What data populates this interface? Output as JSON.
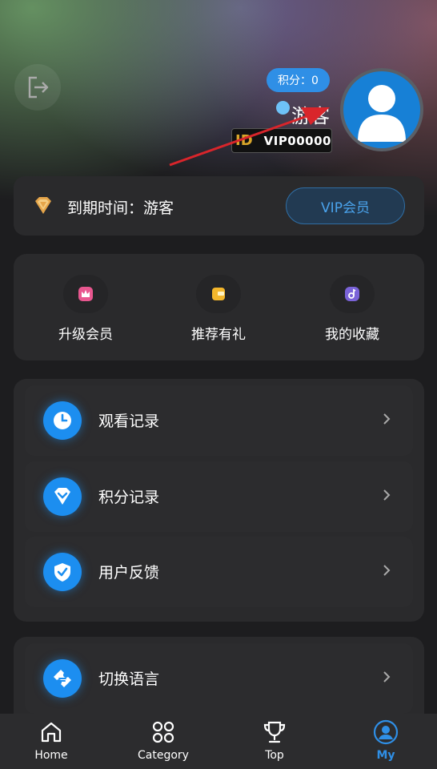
{
  "header": {
    "points_badge": "积分：0",
    "username": "游客",
    "id_tag": "ID",
    "id_value": "VIP00000"
  },
  "vip_bar": {
    "expiry_text": "到期时间：游客",
    "vip_button": "VIP会员"
  },
  "quick_actions": [
    {
      "label": "升级会员",
      "icon": "crown-icon"
    },
    {
      "label": "推荐有礼",
      "icon": "gift-card-icon"
    },
    {
      "label": "我的收藏",
      "icon": "music-note-icon"
    }
  ],
  "menu": [
    {
      "label": "观看记录",
      "icon": "clock-icon"
    },
    {
      "label": "积分记录",
      "icon": "diamond-tag-icon"
    },
    {
      "label": "用户反馈",
      "icon": "shield-icon"
    },
    {
      "label": "切换语言",
      "icon": "ticket-icon"
    }
  ],
  "tabbar": [
    {
      "label": "Home",
      "icon": "home-icon"
    },
    {
      "label": "Category",
      "icon": "category-icon"
    },
    {
      "label": "Top",
      "icon": "trophy-icon"
    },
    {
      "label": "My",
      "icon": "user-circle-icon",
      "active": true
    }
  ],
  "colors": {
    "accent": "#2f8fe6",
    "background": "#1d1d1f",
    "card": "#2a2a2c",
    "arrow": "#d9252b"
  }
}
